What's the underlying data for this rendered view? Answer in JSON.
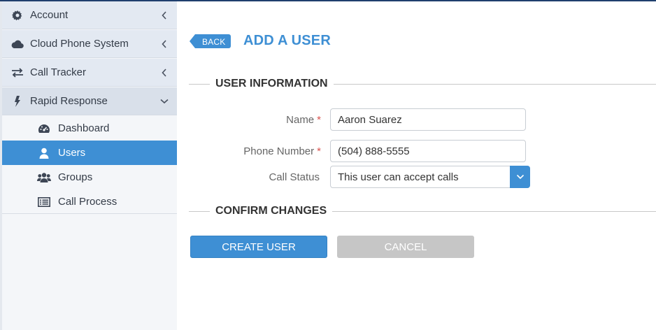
{
  "colors": {
    "accent": "#3e8fd4",
    "sidebar_bg": "#e3e9f2",
    "required": "#d9534f",
    "cancel_bg": "#c6c6c6",
    "topbar": "#1f3f6e"
  },
  "sidebar": {
    "items": [
      {
        "label": "Account",
        "icon": "gear-icon",
        "expanded": false
      },
      {
        "label": "Cloud Phone System",
        "icon": "cloud-icon",
        "expanded": false
      },
      {
        "label": "Call Tracker",
        "icon": "exchange-arrows-icon",
        "expanded": false
      },
      {
        "label": "Rapid Response",
        "icon": "bolt-icon",
        "expanded": true
      }
    ],
    "submenu": [
      {
        "label": "Dashboard",
        "icon": "dashboard-gauge-icon",
        "active": false
      },
      {
        "label": "Users",
        "icon": "user-icon",
        "active": true
      },
      {
        "label": "Groups",
        "icon": "users-group-icon",
        "active": false
      },
      {
        "label": "Call Process",
        "icon": "list-icon",
        "active": false
      }
    ]
  },
  "header": {
    "back_label": "BACK",
    "title": "ADD A USER"
  },
  "sections": {
    "user_info": "USER INFORMATION",
    "confirm": "CONFIRM CHANGES"
  },
  "form": {
    "name": {
      "label": "Name",
      "required_mark": "*",
      "value": "Aaron Suarez"
    },
    "phone": {
      "label": "Phone Number",
      "required_mark": "*",
      "value": "(504) 888-5555"
    },
    "call_status": {
      "label": "Call Status",
      "value": "This user can accept calls"
    }
  },
  "buttons": {
    "create": "CREATE USER",
    "cancel": "CANCEL"
  }
}
